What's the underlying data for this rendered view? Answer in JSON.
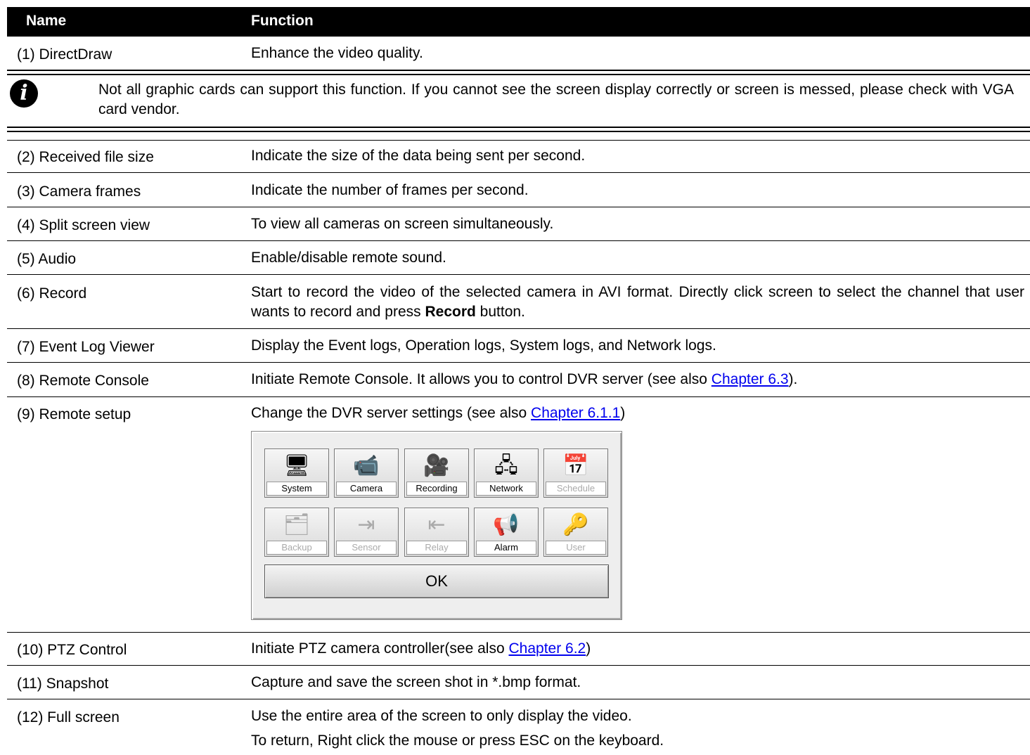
{
  "header": {
    "name": "Name",
    "function": "Function"
  },
  "rows_top": [
    {
      "name": "(1) DirectDraw",
      "function": "Enhance the video quality."
    }
  ],
  "note": {
    "icon": "info-icon",
    "text": "Not all graphic cards can support this function. If you cannot see the screen display correctly or screen is messed, please check with VGA card vendor."
  },
  "rows": [
    {
      "name": "(2) Received file size",
      "function": "Indicate the size of the data being sent per second."
    },
    {
      "name": "(3) Camera frames",
      "function": "Indicate the number of frames per second."
    },
    {
      "name": "(4) Split screen view",
      "function": "To view all cameras on screen simultaneously."
    },
    {
      "name": "(5) Audio",
      "function": "Enable/disable remote sound."
    },
    {
      "name": "(6) Record",
      "function_a": "Start to record the video of the selected camera in AVI format. Directly click screen to select the channel that user wants to record and press ",
      "function_bold": "Record",
      "function_b": " button."
    },
    {
      "name": "(7) Event Log Viewer",
      "function": "Display the Event logs, Operation logs, System logs, and Network logs."
    },
    {
      "name": "(8) Remote Console",
      "function_a": "Initiate Remote Console. It allows you to control DVR server (see also ",
      "link": "Chapter 6.3",
      "function_b": ")."
    },
    {
      "name": "(9) Remote setup",
      "function_a": "Change the DVR server settings (see also ",
      "link": "Chapter 6.1.1",
      "function_b": ")"
    },
    {
      "name": "(10) PTZ Control",
      "function_a": "Initiate PTZ camera controller(see also ",
      "link": "Chapter 6.2",
      "function_b": ")"
    },
    {
      "name": "(11) Snapshot",
      "function": "Capture and save the screen shot in *.bmp format."
    },
    {
      "name": "(12) Full screen",
      "function": "Use the entire area of the screen to only display the video.",
      "function_2": "To return, Right click the mouse or press ESC on the keyboard."
    }
  ],
  "setup_dialog": {
    "tiles": [
      {
        "label": "System",
        "icon": "computer-icon",
        "glyph": "🖥",
        "enabled": true
      },
      {
        "label": "Camera",
        "icon": "camera-icon",
        "glyph": "📹",
        "enabled": true
      },
      {
        "label": "Recording",
        "icon": "movie-camera-icon",
        "glyph": "🎥",
        "enabled": true
      },
      {
        "label": "Network",
        "icon": "network-icon",
        "glyph": "🖧",
        "enabled": true
      },
      {
        "label": "Schedule",
        "icon": "calendar-icon",
        "glyph": "📅",
        "enabled": false
      },
      {
        "label": "Backup",
        "icon": "backup-icon",
        "glyph": "🗂",
        "enabled": false
      },
      {
        "label": "Sensor",
        "icon": "sensor-icon",
        "glyph": "⇥",
        "enabled": false
      },
      {
        "label": "Relay",
        "icon": "relay-icon",
        "glyph": "⇤",
        "enabled": false
      },
      {
        "label": "Alarm",
        "icon": "alarm-icon",
        "glyph": "📢",
        "enabled": true
      },
      {
        "label": "User",
        "icon": "key-icon",
        "glyph": "🔑",
        "enabled": false
      }
    ],
    "ok_label": "OK"
  }
}
